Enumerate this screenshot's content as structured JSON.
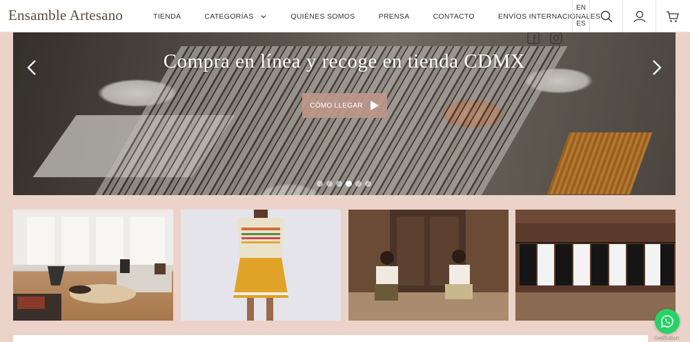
{
  "header": {
    "logo": "Ensamble Artesano",
    "nav": [
      "TIENDA",
      "CATEGORÍAS",
      "QUIÉNES SOMOS",
      "PRENSA",
      "CONTACTO",
      "ENVÍOS INTERNACIONALES"
    ],
    "languages": [
      "EN",
      "ES"
    ],
    "icons": [
      "search-icon",
      "user-icon",
      "cart-icon"
    ]
  },
  "hero": {
    "title": "Compra en línea y recoge en tienda CDMX",
    "button_label": "CÓMO LLEGAR",
    "slides": 6,
    "active_slide": 4,
    "social_icons": [
      "facebook-icon",
      "instagram-icon"
    ]
  },
  "tiles": [
    {
      "name": "living-room-image"
    },
    {
      "name": "girl-dress-image"
    },
    {
      "name": "couple-doorway-image"
    },
    {
      "name": "garments-rack-image"
    }
  ],
  "whatsapp": {
    "badge": "GetButton"
  },
  "colors": {
    "page_bg": "#ecd3ca",
    "button_bg": "#be968a",
    "whatsapp": "#25d366"
  }
}
